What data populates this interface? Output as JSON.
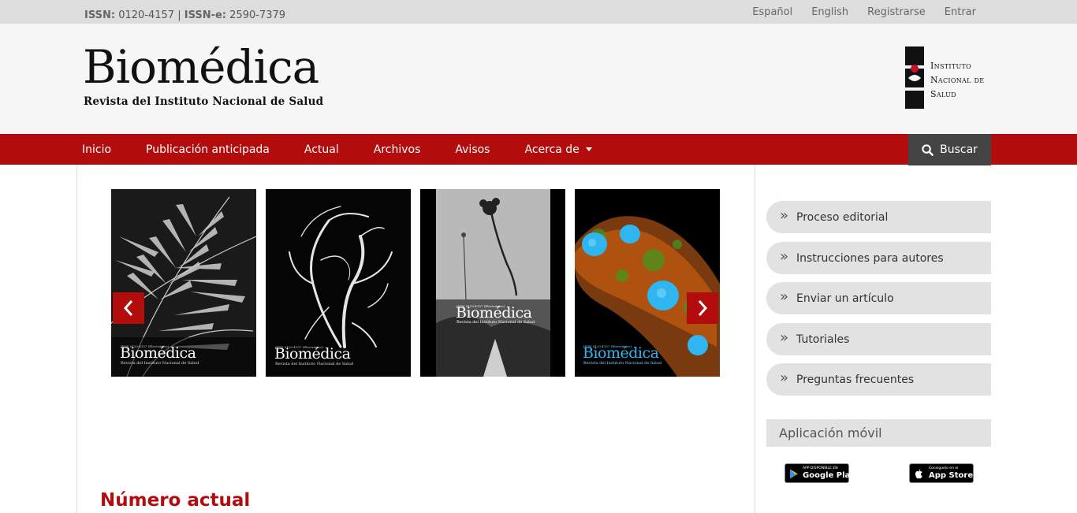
{
  "topbar": {
    "issn_label": "ISSN:",
    "issn_value": "0120-4157",
    "separator": "|",
    "issne_label": "ISSN-e:",
    "issne_value": "2590-7379",
    "links": [
      "Español",
      "English",
      "Registrarse",
      "Entrar"
    ]
  },
  "header": {
    "title": "Biomédica",
    "subtitle": "Revista del Instituto Nacional de Salud",
    "institute_lines": [
      "Instituto",
      "Nacional de",
      "Salud"
    ]
  },
  "nav": {
    "items": [
      "Inicio",
      "Publicación anticipada",
      "Actual",
      "Archivos",
      "Avisos",
      "Acerca de"
    ],
    "search_label": "Buscar"
  },
  "carousel": {
    "covers": [
      {
        "title": "Biomédica",
        "subtitle": "Revista del Instituto Nacional de Salud",
        "theme": "fern"
      },
      {
        "title": "Biomédica",
        "subtitle": "Revista del Instituto Nacional de Salud",
        "theme": "angiography"
      },
      {
        "title": "Biomédica",
        "subtitle": "Revista del Instituto Nacional de Salud",
        "theme": "paramo"
      },
      {
        "title": "Biomédica",
        "subtitle": "Revista del Instituto Nacional de Salud",
        "theme": "cells"
      }
    ]
  },
  "main": {
    "current_issue_heading": "Número actual"
  },
  "sidebar": {
    "items": [
      "Proceso editorial",
      "Instrucciones para autores",
      "Enviar un artículo",
      "Tutoriales",
      "Preguntas frecuentes"
    ],
    "app_title": "Aplicación móvil",
    "google_play": {
      "small": "APP DISPONIBLE EN",
      "big": "Google Play"
    },
    "app_store": {
      "small": "Consíguelo en el",
      "big": "App Store"
    }
  },
  "colors": {
    "brand_red": "#b30c0c",
    "topbar_bg": "#dddddd",
    "header_bg": "#f6f6f6"
  }
}
